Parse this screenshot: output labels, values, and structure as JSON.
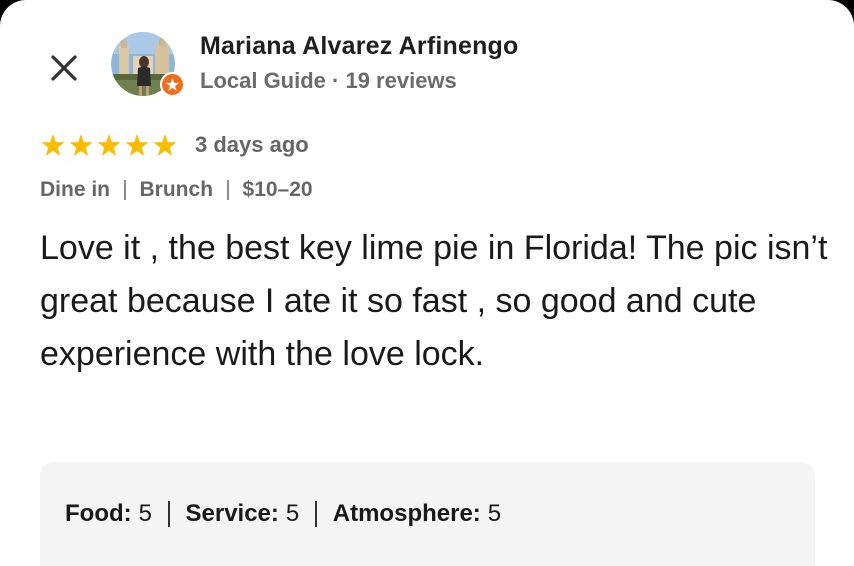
{
  "header": {
    "close_icon": "close-icon",
    "reviewer": {
      "name": "Mariana Alvarez Arfinengo",
      "meta": "Local Guide · 19 reviews",
      "badge_icon": "local-guide-star-icon"
    }
  },
  "review": {
    "rating": 5,
    "max_rating": 5,
    "star_color": "#fbbc04",
    "date": "3 days ago",
    "tags": [
      "Dine in",
      "Brunch",
      "$10–20"
    ],
    "text": "Love it , the best key lime pie in Florida! The pic isn’t great because I ate it so fast , so good and cute experience with the love lock."
  },
  "sub_ratings": [
    {
      "label": "Food:",
      "value": "5"
    },
    {
      "label": "Service:",
      "value": "5"
    },
    {
      "label": "Atmosphere:",
      "value": "5"
    }
  ],
  "colors": {
    "badge": "#f06d1b",
    "sub_ratings_bg": "#f4f4f4",
    "muted_text": "#666666"
  }
}
